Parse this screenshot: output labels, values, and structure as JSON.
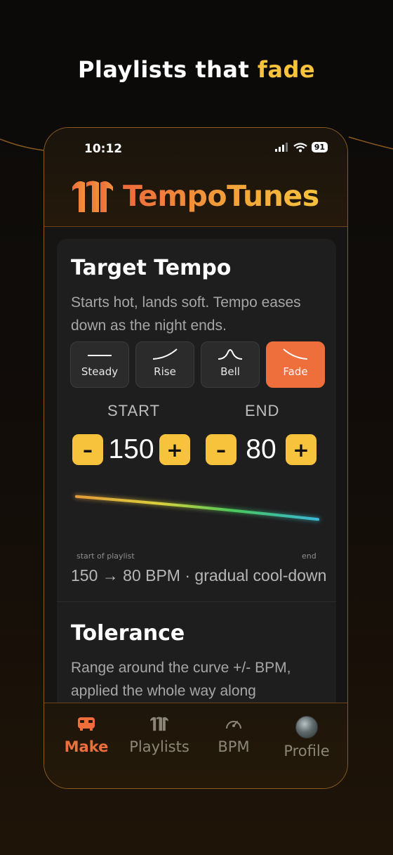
{
  "headline": {
    "before": "Playlists that ",
    "accent": "fade"
  },
  "status": {
    "time": "10:12",
    "battery": "91"
  },
  "app": {
    "name": "TempoTunes"
  },
  "target": {
    "title": "Target Tempo",
    "description": "Starts hot, lands soft. Tempo eases down as the night ends."
  },
  "curves": [
    {
      "label": "Steady"
    },
    {
      "label": "Rise"
    },
    {
      "label": "Bell"
    },
    {
      "label": "Fade",
      "active": true
    }
  ],
  "start": {
    "label": "START",
    "value": "150"
  },
  "end": {
    "label": "END",
    "value": "80"
  },
  "stepper": {
    "minus": "–",
    "plus": "+"
  },
  "chart_data": {
    "type": "line",
    "x": [
      "start of playlist",
      "end"
    ],
    "values": [
      150,
      80
    ],
    "xlabel_start": "start of playlist",
    "xlabel_end": "end"
  },
  "summary": "150 → 80 BPM · gradual cool-down",
  "tolerance": {
    "title": "Tolerance",
    "description": "Range around the curve +/- BPM, applied the whole way along"
  },
  "tabs": [
    {
      "label": "Make",
      "icon": "bus-icon",
      "active": true
    },
    {
      "label": "Playlists",
      "icon": "tempotunes-logo-icon"
    },
    {
      "label": "BPM",
      "icon": "gauge-icon"
    },
    {
      "label": "Profile",
      "icon": "avatar"
    }
  ],
  "colors": {
    "accent": "#ee6e3c",
    "yellow": "#f7c23c"
  }
}
